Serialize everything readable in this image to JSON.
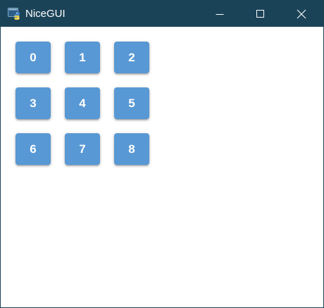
{
  "window": {
    "title": "NiceGUI",
    "titlebar_color": "#1b4358"
  },
  "controls": {
    "minimize_icon": "minimize-icon",
    "maximize_icon": "maximize-icon",
    "close_icon": "close-icon"
  },
  "theme": {
    "button_color": "#5898d4",
    "button_text_color": "#ffffff"
  },
  "buttons": [
    {
      "label": "0"
    },
    {
      "label": "1"
    },
    {
      "label": "2"
    },
    {
      "label": "3"
    },
    {
      "label": "4"
    },
    {
      "label": "5"
    },
    {
      "label": "6"
    },
    {
      "label": "7"
    },
    {
      "label": "8"
    }
  ]
}
